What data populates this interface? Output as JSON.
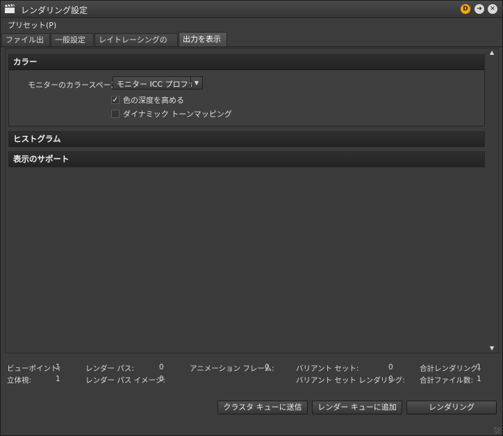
{
  "window": {
    "title": "レンダリング設定",
    "title_icon": "clapperboard-icon"
  },
  "titlebar_buttons": {
    "d_label": "D",
    "arrow_icon": "arrow-right-icon",
    "close_icon": "close-icon"
  },
  "menu": {
    "preset": "プリセット(P)"
  },
  "tabs": [
    {
      "label": "ファイル出力"
    },
    {
      "label": "一般設定"
    },
    {
      "label": "レイトレーシングの精度"
    },
    {
      "label": "出力を表示",
      "active": true
    }
  ],
  "sections": {
    "color": {
      "title": "カラー",
      "monitor_colorspace_label": "モニターのカラースペース",
      "monitor_colorspace_value": "モニター ICC プロファイ",
      "checkbox_color_depth": {
        "label": "色の深度を高める",
        "checked": true
      },
      "checkbox_tone_mapping": {
        "label": "ダイナミック トーンマッピング",
        "checked": false
      }
    },
    "histogram": {
      "title": "ヒストグラム"
    },
    "display_support": {
      "title": "表示のサポート"
    }
  },
  "status": {
    "viewpoint_label": "ビューポイント:",
    "viewpoint_value": "1",
    "stereo_label": "立体視:",
    "stereo_value": "1",
    "render_pass_label": "レンダー パス:",
    "render_pass_value": "0",
    "render_pass_image_label": "レンダー パス イメージ:",
    "render_pass_image_value": "0",
    "animation_frame_label": "アニメーション フレーム:",
    "animation_frame_value": "0",
    "variant_set_label": "バリアント セット:",
    "variant_set_value": "0",
    "variant_set_rendering_label": "バリアント セット レンダリング:",
    "variant_set_rendering_value": "0",
    "total_rendering_label": "合計レンダリング:",
    "total_rendering_value": "1",
    "total_files_label": "合計ファイル数:",
    "total_files_value": "1"
  },
  "buttons": {
    "send_cluster": "クラスタ キューに送信",
    "add_render_queue": "レンダー キューに追加",
    "render": "レンダリング"
  }
}
